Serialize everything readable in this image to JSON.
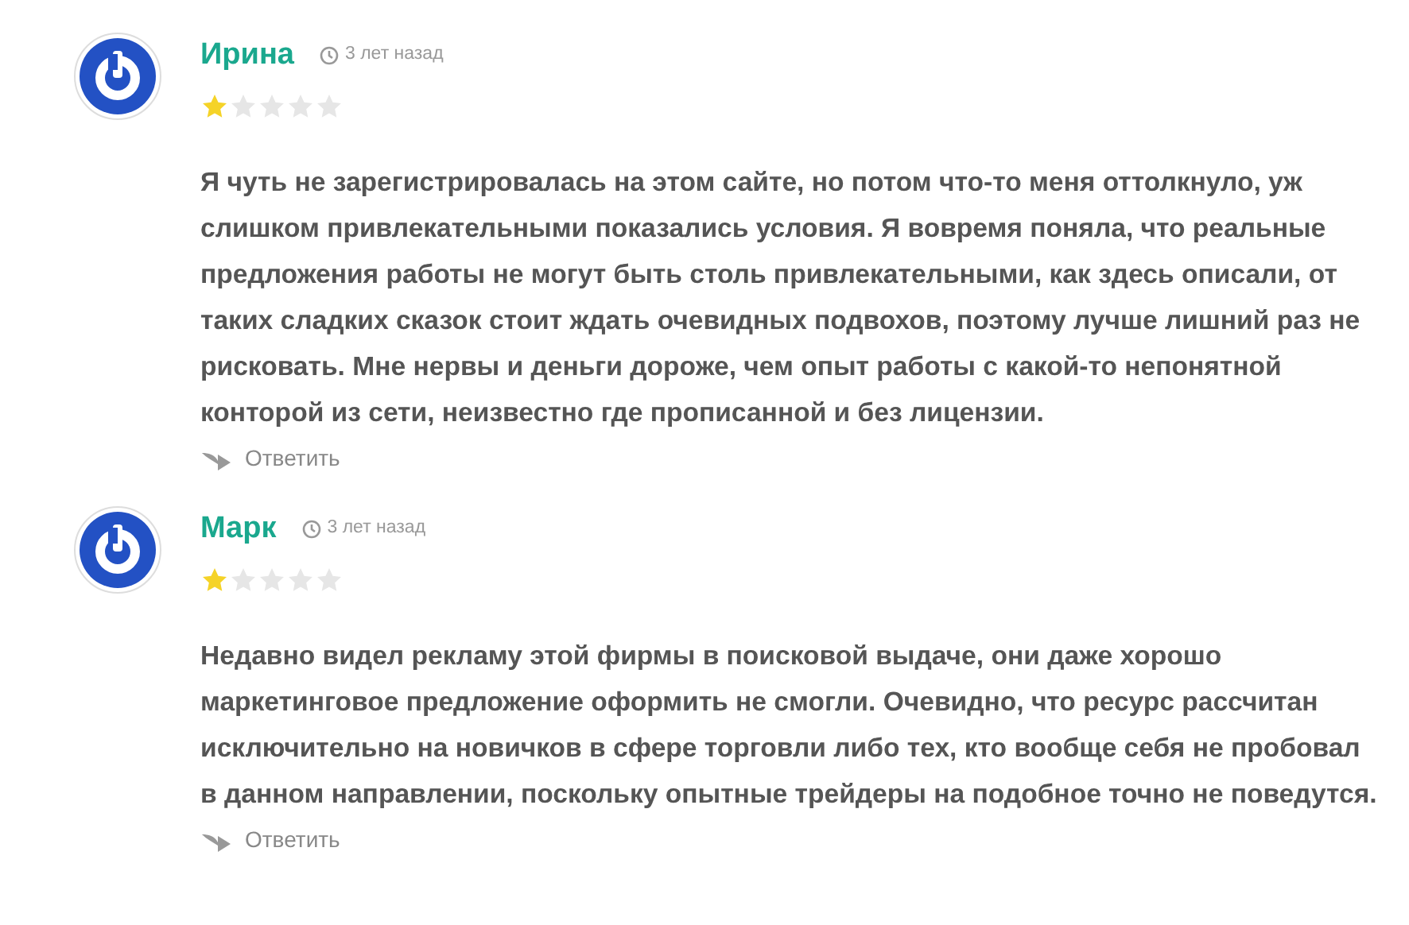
{
  "comments": [
    {
      "author": "Ирина",
      "time": "3 лет назад",
      "stars": 1,
      "text": "Я чуть не зарегистрировалась на этом сайте, но потом что-то меня оттолкнуло, уж слишком привлекательными показались условия. Я вовремя поняла, что реальные предложения работы не могут быть столь привлекательными, как здесь описали, от таких сладких сказок стоит ждать очевидных подвохов, поэтому лучше лишний раз не рисковать. Мне нервы и деньги дороже, чем опыт работы с какой-то непонятной конторой из сети, неизвестно где прописанной и без лицензии.",
      "reply": "Ответить"
    },
    {
      "author": "Марк",
      "time": "3 лет назад",
      "stars": 1,
      "text": "Недавно видел рекламу этой фирмы в поисковой выдаче, они даже хорошо маркетинговое предложение оформить не смогли. Очевидно, что ресурс рассчитан исключительно на новичков в сфере торговли либо тех, кто вообще себя не пробовал в данном направлении, поскольку опытные трейдеры на подобное точно не поведутся.",
      "reply": "Ответить"
    }
  ]
}
